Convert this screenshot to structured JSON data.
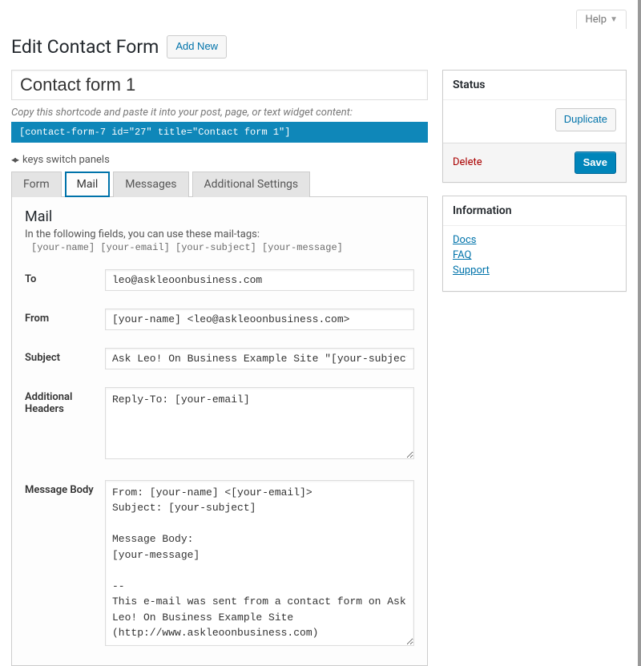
{
  "top": {
    "help": "Help"
  },
  "heading": {
    "title": "Edit Contact Form",
    "add_new": "Add New"
  },
  "editor": {
    "title_value": "Contact form 1",
    "shortcode_hint": "Copy this shortcode and paste it into your post, page, or text widget content:",
    "shortcode": "[contact-form-7 id=\"27\" title=\"Contact form 1\"]",
    "keys_hint": "keys switch panels"
  },
  "tabs": {
    "form": "Form",
    "mail": "Mail",
    "messages": "Messages",
    "additional": "Additional Settings"
  },
  "mail_panel": {
    "heading": "Mail",
    "intro": "In the following fields, you can use these mail-tags:",
    "tags": "[your-name] [your-email] [your-subject] [your-message]",
    "labels": {
      "to": "To",
      "from": "From",
      "subject": "Subject",
      "additional_headers": "Additional Headers",
      "message_body": "Message Body"
    },
    "values": {
      "to": "leo@askleoonbusiness.com",
      "from": "[your-name] <leo@askleoonbusiness.com>",
      "subject": "Ask Leo! On Business Example Site \"[your-subject]\"",
      "additional_headers": "Reply-To: [your-email]",
      "message_body": "From: [your-name] <[your-email]>\nSubject: [your-subject]\n\nMessage Body:\n[your-message]\n\n--\nThis e-mail was sent from a contact form on Ask Leo! On Business Example Site (http://www.askleoonbusiness.com)"
    }
  },
  "sidebar": {
    "status": {
      "title": "Status",
      "duplicate": "Duplicate",
      "delete": "Delete",
      "save": "Save"
    },
    "info": {
      "title": "Information",
      "links": {
        "docs": "Docs",
        "faq": "FAQ",
        "support": "Support"
      }
    }
  }
}
